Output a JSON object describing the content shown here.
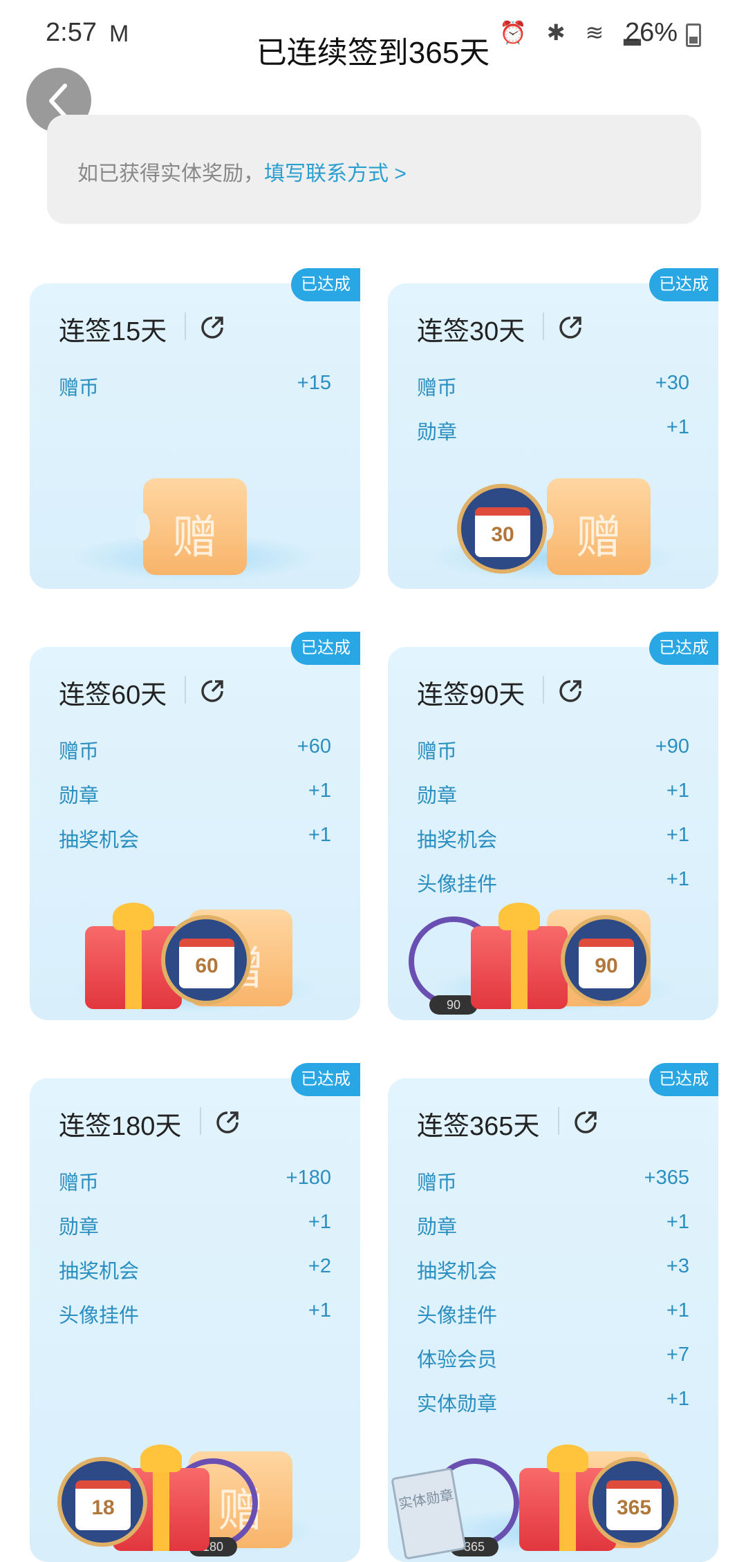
{
  "status_bar": {
    "time": "2:57",
    "mail_icon": "M",
    "icons": "⏰ ✱ ≋ ▂",
    "battery": "26%"
  },
  "page_title": "已连续签到365天",
  "notice": {
    "text": "如已获得实体奖励，",
    "link": "填写联系方式 >"
  },
  "cards": [
    {
      "badge": "已达成",
      "title": "连签15天",
      "rows": [
        [
          "赠币",
          "+15"
        ]
      ]
    },
    {
      "badge": "已达成",
      "title": "连签30天",
      "rows": [
        [
          "赠币",
          "+30"
        ],
        [
          "勋章",
          "+1"
        ]
      ],
      "medal": "30"
    },
    {
      "badge": "已达成",
      "title": "连签60天",
      "rows": [
        [
          "赠币",
          "+60"
        ],
        [
          "勋章",
          "+1"
        ],
        [
          "抽奖机会",
          "+1"
        ]
      ],
      "medal": "60"
    },
    {
      "badge": "已达成",
      "title": "连签90天",
      "rows": [
        [
          "赠币",
          "+90"
        ],
        [
          "勋章",
          "+1"
        ],
        [
          "抽奖机会",
          "+1"
        ],
        [
          "头像挂件",
          "+1"
        ]
      ],
      "medal": "90",
      "ring": "90"
    },
    {
      "badge": "已达成",
      "title": "连签180天",
      "rows": [
        [
          "赠币",
          "+180"
        ],
        [
          "勋章",
          "+1"
        ],
        [
          "抽奖机会",
          "+2"
        ],
        [
          "头像挂件",
          "+1"
        ]
      ],
      "medal": "18",
      "ring": "180"
    },
    {
      "badge": "已达成",
      "title": "连签365天",
      "rows": [
        [
          "赠币",
          "+365"
        ],
        [
          "勋章",
          "+1"
        ],
        [
          "抽奖机会",
          "+3"
        ],
        [
          "头像挂件",
          "+1"
        ],
        [
          "体验会员",
          "+7"
        ],
        [
          "实体勋章",
          "+1"
        ]
      ],
      "medal": "365",
      "ring": "365",
      "book": "实体勋章",
      "card7": "7"
    }
  ],
  "ticket_glyph": "赠",
  "icons": {
    "back": "chevron-left-icon",
    "share": "share-icon"
  },
  "colors": {
    "accent": "#29a7e4",
    "link": "#2a9fd0",
    "card_bg": "#e2f4fd"
  }
}
